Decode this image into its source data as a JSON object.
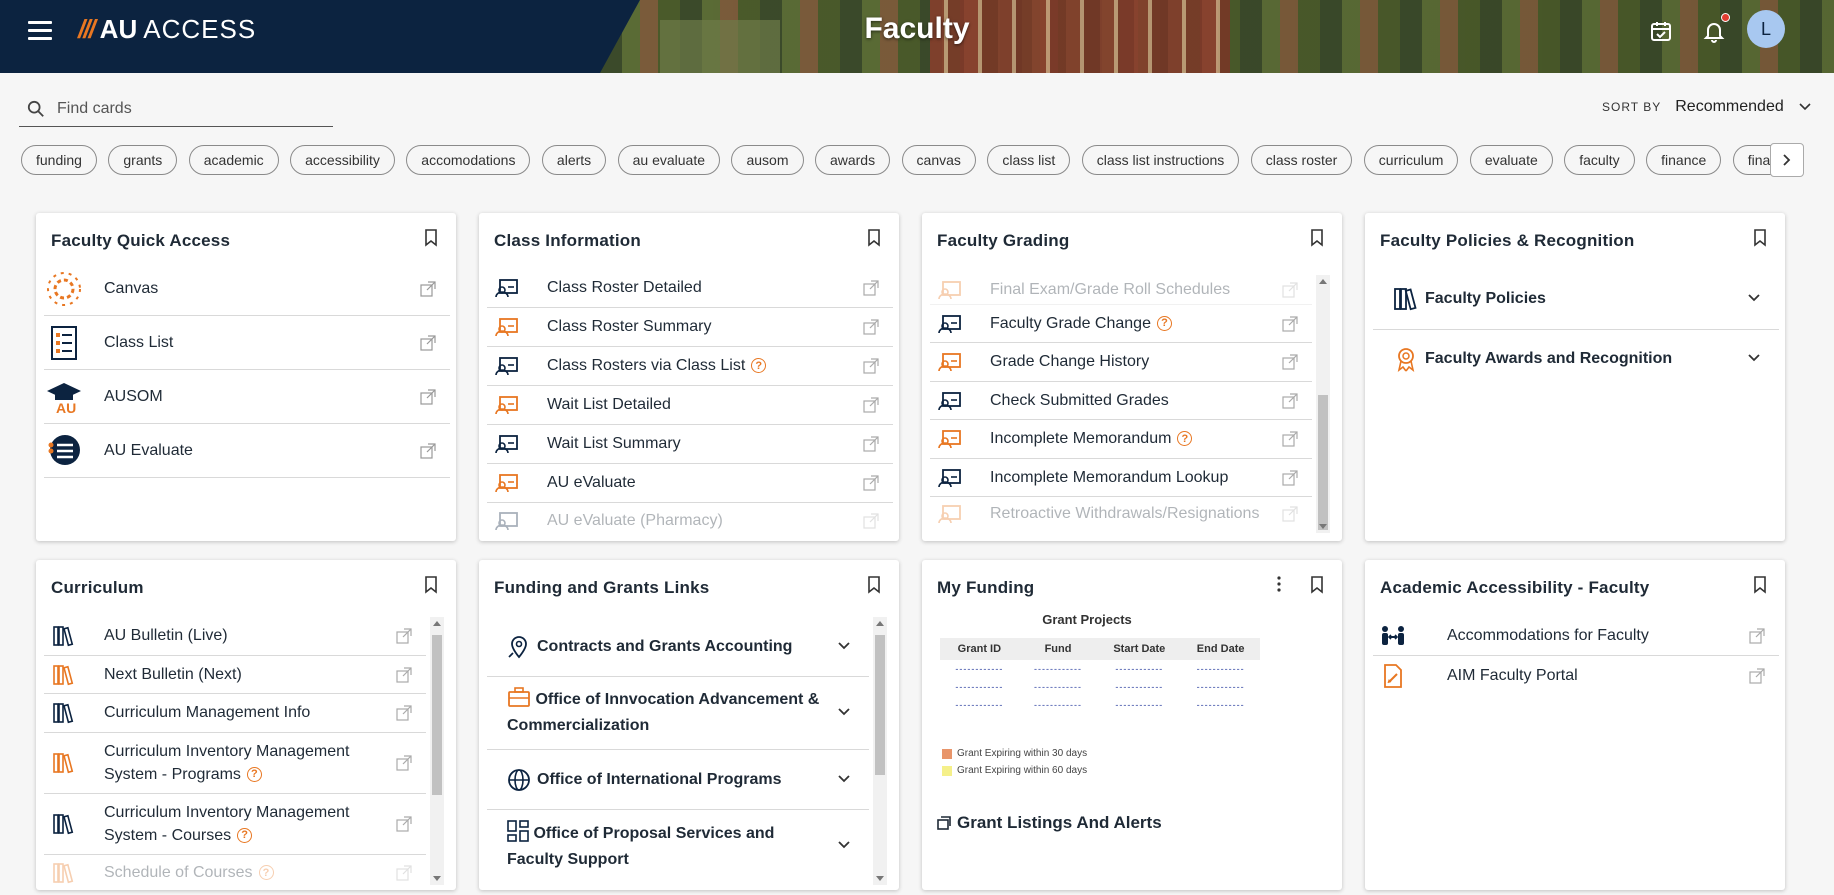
{
  "header": {
    "logo_mark": "///",
    "logo_au": "AU",
    "logo_access": "ACCESS",
    "title": "Faculty",
    "avatar_initial": "L"
  },
  "search": {
    "placeholder": "Find cards"
  },
  "sort": {
    "label": "SORT BY",
    "value": "Recommended"
  },
  "chips": [
    "funding",
    "grants",
    "academic",
    "accessibility",
    "accomodations",
    "alerts",
    "au evaluate",
    "ausom",
    "awards",
    "canvas",
    "class list",
    "class list instructions",
    "class roster",
    "curriculum",
    "evaluate",
    "faculty",
    "finance",
    "finance"
  ],
  "cards": {
    "quick_access": {
      "title": "Faculty Quick Access",
      "items": [
        "Canvas",
        "Class List",
        "AUSOM",
        "AU Evaluate"
      ]
    },
    "class_info": {
      "title": "Class Information",
      "items": [
        "Class Roster Detailed",
        "Class Roster Summary",
        "Class Rosters via Class List",
        "Wait List Detailed",
        "Wait List Summary",
        "AU eValuate",
        "AU eValuate (Pharmacy)"
      ]
    },
    "grading": {
      "title": "Faculty Grading",
      "items": [
        "Final Exam/Grade Roll Schedules",
        "Faculty Grade Change",
        "Grade Change History",
        "Check Submitted Grades",
        "Incomplete Memorandum",
        "Incomplete Memorandum Lookup",
        "Retroactive Withdrawals/Resignations"
      ]
    },
    "policies": {
      "title": "Faculty Policies & Recognition",
      "items": [
        "Faculty Policies",
        "Faculty Awards and Recognition"
      ]
    },
    "curriculum": {
      "title": "Curriculum",
      "items": [
        "AU Bulletin (Live)",
        "Next Bulletin (Next)",
        "Curriculum Management Info",
        "Curriculum Inventory Management System - Programs",
        "Curriculum Inventory Management System - Courses",
        "Schedule of Courses"
      ]
    },
    "funding_links": {
      "title": "Funding and Grants Links",
      "items": [
        "Contracts and Grants Accounting",
        "Office of Innvocation Advancement & Commercialization",
        "Office of International Programs",
        "Office of Proposal Services and Faculty Support"
      ]
    },
    "my_funding": {
      "title": "My Funding",
      "subtitle": "Grant Projects",
      "columns": [
        "Grant ID",
        "Fund",
        "Start Date",
        "End Date"
      ],
      "rows": [
        [
          "------------",
          "------------",
          "------------",
          "------------"
        ],
        [
          "------------",
          "------------",
          "------------",
          "------------"
        ],
        [
          "------------",
          "------------",
          "------------",
          "------------"
        ]
      ],
      "legend": [
        "Grant Expiring within 30 days",
        "Grant Expiring within 60 days"
      ],
      "legend_colors": [
        "#e8956a",
        "#f5f08a"
      ],
      "listings_title": "Grant Listings And Alerts"
    },
    "accessibility": {
      "title": "Academic Accessibility - Faculty",
      "items": [
        "Accommodations for Faculty",
        "AIM Faculty Portal"
      ]
    }
  },
  "colors": {
    "navy": "#0c2340",
    "orange": "#e87722"
  }
}
